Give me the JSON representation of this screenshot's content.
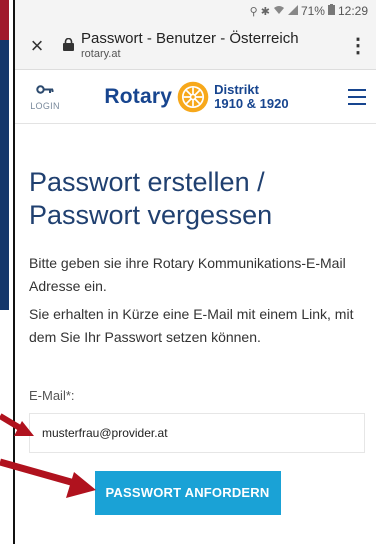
{
  "status_bar": {
    "battery": "71%",
    "time": "12:29",
    "icons": [
      "location-icon",
      "bluetooth-icon",
      "wifi-icon",
      "signal-icon",
      "battery-icon"
    ]
  },
  "browser": {
    "close_icon": "close-icon",
    "lock_icon": "lock-icon",
    "tab_title": "Passwort - Benutzer - Österreich",
    "host": "rotary.at",
    "menu_icon": "more-vert-icon"
  },
  "site_header": {
    "login_label": "LOGIN",
    "brand_name": "Rotary",
    "district_line1": "Distrikt",
    "district_line2": "1910 & 1920",
    "menu_icon": "hamburger-icon"
  },
  "form": {
    "heading": "Passwort erstellen / Passwort vergessen",
    "intro_1": "Bitte geben sie ihre Rotary Kommunikations-E-Mail Adresse ein.",
    "intro_2": "Sie erhalten in Kürze eine E-Mail mit einem Link, mit dem Sie Ihr Passwort setzen können.",
    "email_label": "E-Mail*:",
    "email_value": "musterfrau@provider.at",
    "submit_label": "PASSWORT ANFORDERN"
  },
  "colors": {
    "brand_blue": "#17458f",
    "heading_blue": "#204070",
    "button": "#1aa2d6",
    "annotation_arrow": "#b0121e"
  }
}
